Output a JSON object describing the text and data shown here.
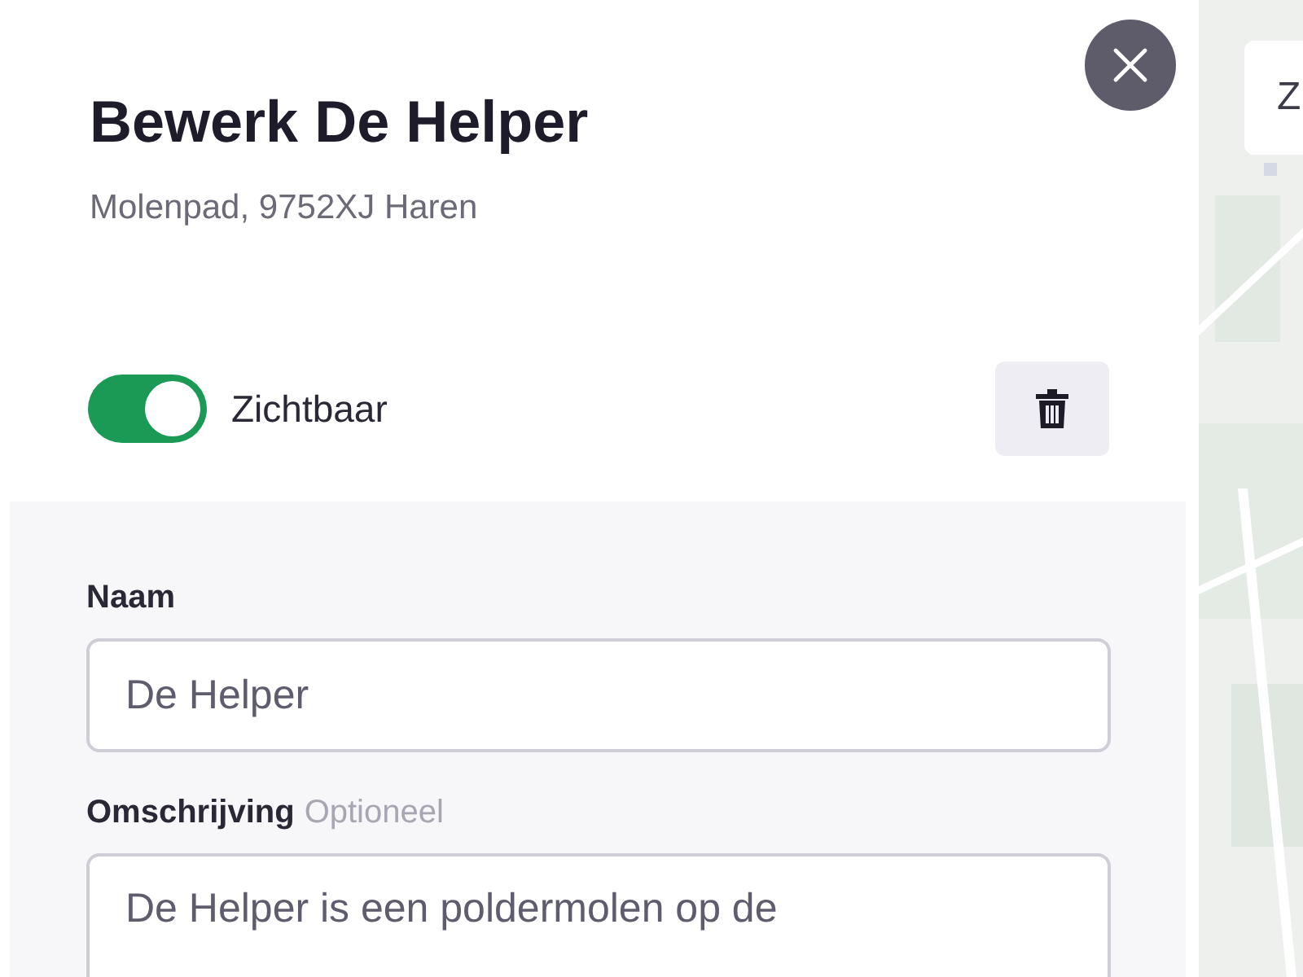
{
  "header": {
    "title": "Bewerk De Helper",
    "address": "Molenpad, 9752XJ Haren"
  },
  "visibility": {
    "label": "Zichtbaar",
    "on": true
  },
  "form": {
    "fields": [
      {
        "label": "Naam",
        "value": "De Helper",
        "kind": "input"
      },
      {
        "label": "Omschrijving",
        "hint": "Optioneel",
        "value": "De Helper is een poldermolen op de",
        "kind": "textarea"
      }
    ]
  },
  "map": {
    "kind": "picture",
    "button": {
      "label": "Z"
    }
  }
}
